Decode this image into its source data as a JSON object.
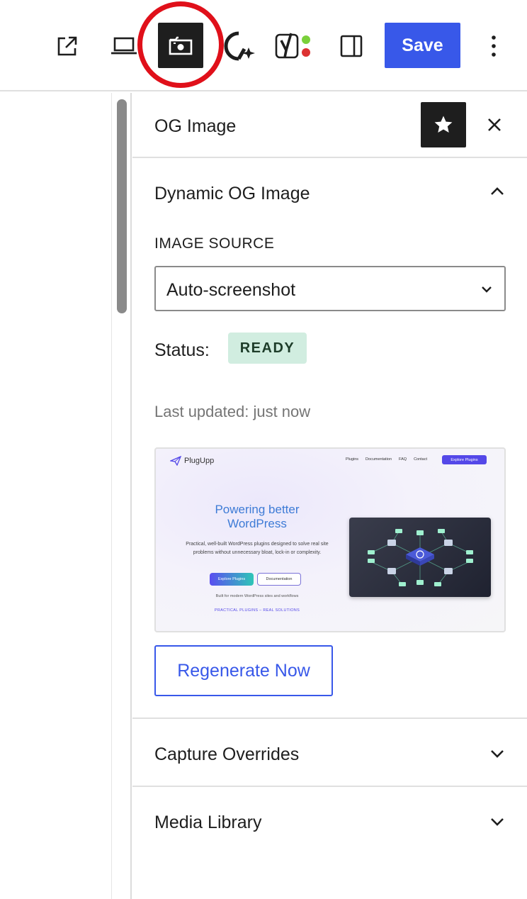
{
  "toolbar": {
    "save_label": "Save",
    "icons": [
      "external-link-icon",
      "laptop-preview-icon",
      "og-image-camera-icon",
      "performance-plugin-icon",
      "yoast-seo-icon",
      "sidebar-panel-icon",
      "more-options-icon"
    ],
    "accent_color": "#3858e9",
    "highlight_ring_color": "#e0101a"
  },
  "sidebar": {
    "title": "OG Image",
    "og_panel": {
      "title": "Dynamic OG Image",
      "expanded": true,
      "image_source_label": "IMAGE SOURCE",
      "image_source_value": "Auto-screenshot",
      "status_label": "Status:",
      "status_value": "READY",
      "status_color": "#d1ede0",
      "last_updated": "Last updated: just now",
      "preview": {
        "logo_text": "PlugUpp",
        "nav": [
          "Plugins",
          "Documentation",
          "FAQ",
          "Contact"
        ],
        "nav_cta": "Explore Plugins",
        "heading_line1": "Powering better",
        "heading_line2": "WordPress",
        "description": "Practical, well-built WordPress plugins designed to solve real site problems without unnecessary bloat, lock-in or complexity.",
        "primary_button": "Explore Plugins",
        "secondary_button": "Documentation",
        "note": "Built for modern WordPress sites and workflows",
        "tagline": "PRACTICAL PLUGINS – REAL SOLUTIONS"
      },
      "regenerate_label": "Regenerate Now"
    },
    "capture_panel": {
      "title": "Capture Overrides",
      "expanded": false
    },
    "media_panel": {
      "title": "Media Library",
      "expanded": false
    }
  }
}
